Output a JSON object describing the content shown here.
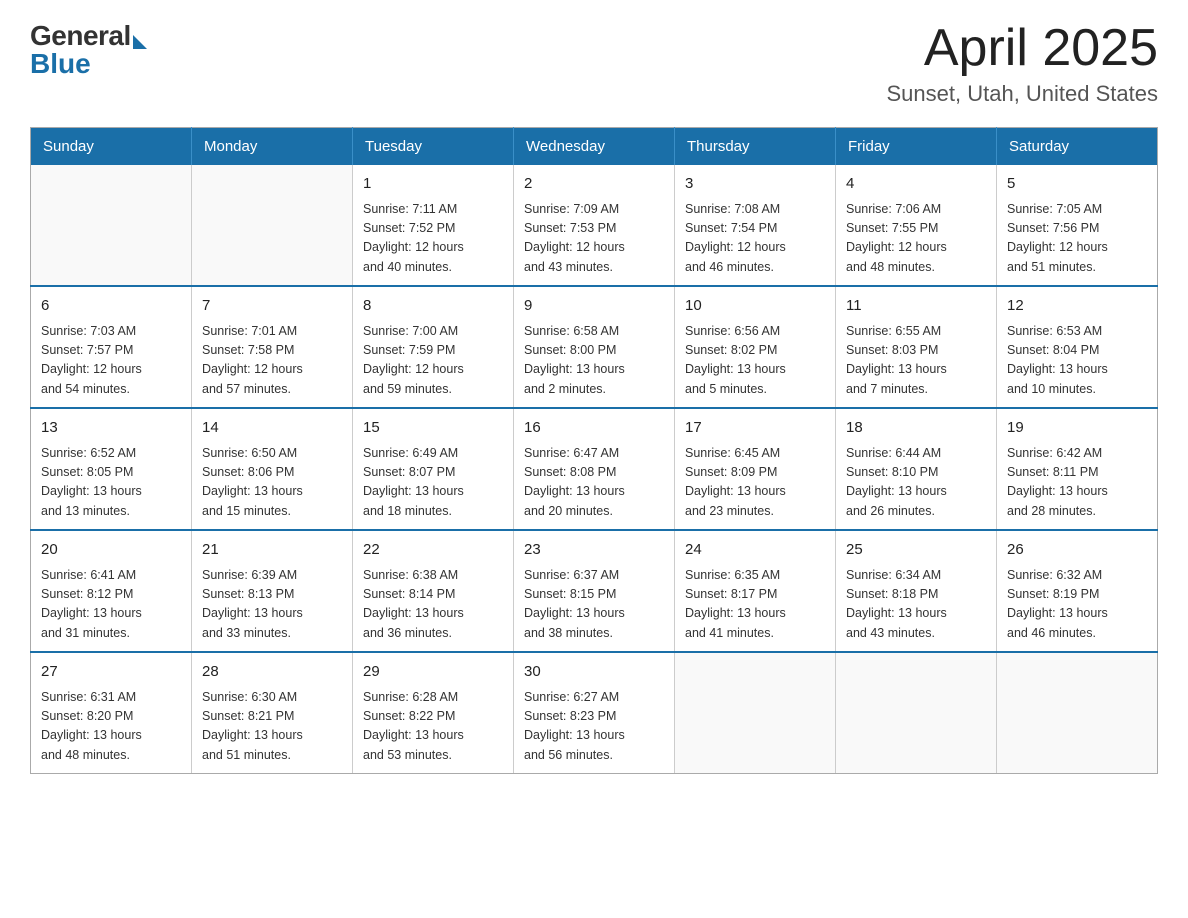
{
  "header": {
    "logo_general": "General",
    "logo_blue": "Blue",
    "title": "April 2025",
    "subtitle": "Sunset, Utah, United States"
  },
  "weekdays": [
    "Sunday",
    "Monday",
    "Tuesday",
    "Wednesday",
    "Thursday",
    "Friday",
    "Saturday"
  ],
  "weeks": [
    [
      {
        "day": "",
        "info": ""
      },
      {
        "day": "",
        "info": ""
      },
      {
        "day": "1",
        "info": "Sunrise: 7:11 AM\nSunset: 7:52 PM\nDaylight: 12 hours\nand 40 minutes."
      },
      {
        "day": "2",
        "info": "Sunrise: 7:09 AM\nSunset: 7:53 PM\nDaylight: 12 hours\nand 43 minutes."
      },
      {
        "day": "3",
        "info": "Sunrise: 7:08 AM\nSunset: 7:54 PM\nDaylight: 12 hours\nand 46 minutes."
      },
      {
        "day": "4",
        "info": "Sunrise: 7:06 AM\nSunset: 7:55 PM\nDaylight: 12 hours\nand 48 minutes."
      },
      {
        "day": "5",
        "info": "Sunrise: 7:05 AM\nSunset: 7:56 PM\nDaylight: 12 hours\nand 51 minutes."
      }
    ],
    [
      {
        "day": "6",
        "info": "Sunrise: 7:03 AM\nSunset: 7:57 PM\nDaylight: 12 hours\nand 54 minutes."
      },
      {
        "day": "7",
        "info": "Sunrise: 7:01 AM\nSunset: 7:58 PM\nDaylight: 12 hours\nand 57 minutes."
      },
      {
        "day": "8",
        "info": "Sunrise: 7:00 AM\nSunset: 7:59 PM\nDaylight: 12 hours\nand 59 minutes."
      },
      {
        "day": "9",
        "info": "Sunrise: 6:58 AM\nSunset: 8:00 PM\nDaylight: 13 hours\nand 2 minutes."
      },
      {
        "day": "10",
        "info": "Sunrise: 6:56 AM\nSunset: 8:02 PM\nDaylight: 13 hours\nand 5 minutes."
      },
      {
        "day": "11",
        "info": "Sunrise: 6:55 AM\nSunset: 8:03 PM\nDaylight: 13 hours\nand 7 minutes."
      },
      {
        "day": "12",
        "info": "Sunrise: 6:53 AM\nSunset: 8:04 PM\nDaylight: 13 hours\nand 10 minutes."
      }
    ],
    [
      {
        "day": "13",
        "info": "Sunrise: 6:52 AM\nSunset: 8:05 PM\nDaylight: 13 hours\nand 13 minutes."
      },
      {
        "day": "14",
        "info": "Sunrise: 6:50 AM\nSunset: 8:06 PM\nDaylight: 13 hours\nand 15 minutes."
      },
      {
        "day": "15",
        "info": "Sunrise: 6:49 AM\nSunset: 8:07 PM\nDaylight: 13 hours\nand 18 minutes."
      },
      {
        "day": "16",
        "info": "Sunrise: 6:47 AM\nSunset: 8:08 PM\nDaylight: 13 hours\nand 20 minutes."
      },
      {
        "day": "17",
        "info": "Sunrise: 6:45 AM\nSunset: 8:09 PM\nDaylight: 13 hours\nand 23 minutes."
      },
      {
        "day": "18",
        "info": "Sunrise: 6:44 AM\nSunset: 8:10 PM\nDaylight: 13 hours\nand 26 minutes."
      },
      {
        "day": "19",
        "info": "Sunrise: 6:42 AM\nSunset: 8:11 PM\nDaylight: 13 hours\nand 28 minutes."
      }
    ],
    [
      {
        "day": "20",
        "info": "Sunrise: 6:41 AM\nSunset: 8:12 PM\nDaylight: 13 hours\nand 31 minutes."
      },
      {
        "day": "21",
        "info": "Sunrise: 6:39 AM\nSunset: 8:13 PM\nDaylight: 13 hours\nand 33 minutes."
      },
      {
        "day": "22",
        "info": "Sunrise: 6:38 AM\nSunset: 8:14 PM\nDaylight: 13 hours\nand 36 minutes."
      },
      {
        "day": "23",
        "info": "Sunrise: 6:37 AM\nSunset: 8:15 PM\nDaylight: 13 hours\nand 38 minutes."
      },
      {
        "day": "24",
        "info": "Sunrise: 6:35 AM\nSunset: 8:17 PM\nDaylight: 13 hours\nand 41 minutes."
      },
      {
        "day": "25",
        "info": "Sunrise: 6:34 AM\nSunset: 8:18 PM\nDaylight: 13 hours\nand 43 minutes."
      },
      {
        "day": "26",
        "info": "Sunrise: 6:32 AM\nSunset: 8:19 PM\nDaylight: 13 hours\nand 46 minutes."
      }
    ],
    [
      {
        "day": "27",
        "info": "Sunrise: 6:31 AM\nSunset: 8:20 PM\nDaylight: 13 hours\nand 48 minutes."
      },
      {
        "day": "28",
        "info": "Sunrise: 6:30 AM\nSunset: 8:21 PM\nDaylight: 13 hours\nand 51 minutes."
      },
      {
        "day": "29",
        "info": "Sunrise: 6:28 AM\nSunset: 8:22 PM\nDaylight: 13 hours\nand 53 minutes."
      },
      {
        "day": "30",
        "info": "Sunrise: 6:27 AM\nSunset: 8:23 PM\nDaylight: 13 hours\nand 56 minutes."
      },
      {
        "day": "",
        "info": ""
      },
      {
        "day": "",
        "info": ""
      },
      {
        "day": "",
        "info": ""
      }
    ]
  ]
}
